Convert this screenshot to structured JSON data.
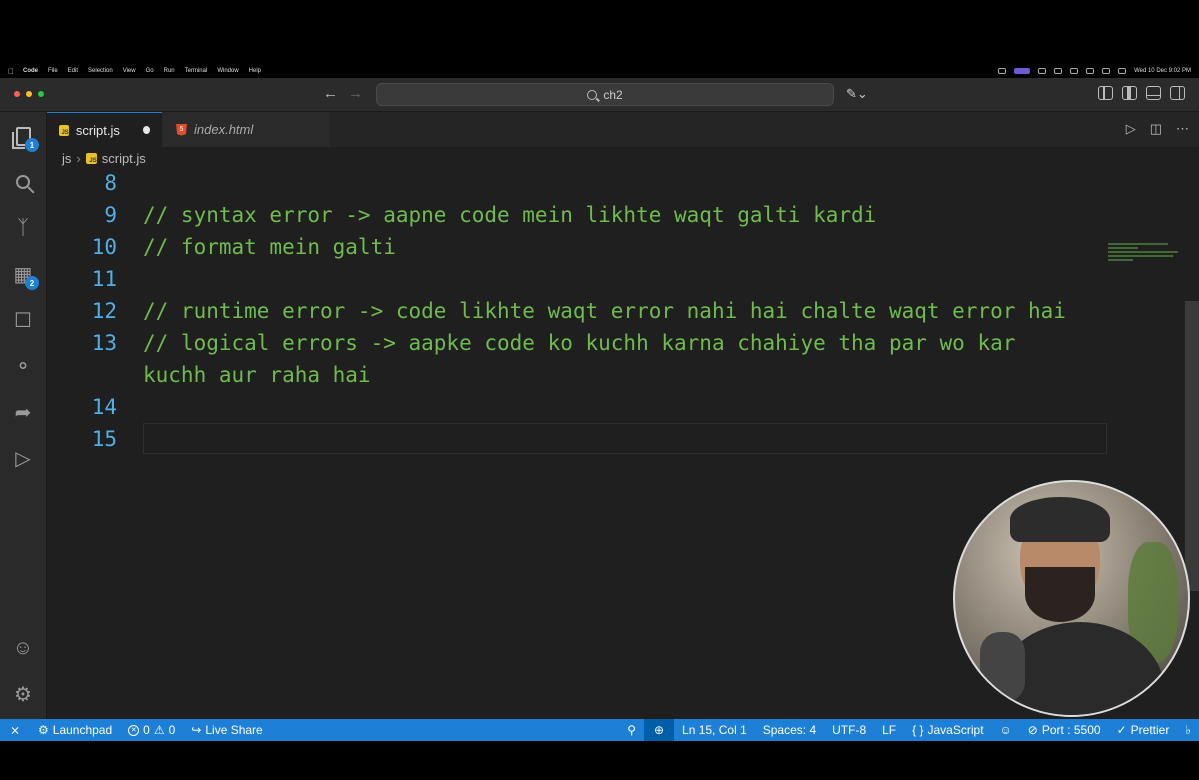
{
  "menubar": {
    "app": "Code",
    "items": [
      "File",
      "Edit",
      "Selection",
      "View",
      "Go",
      "Run",
      "Terminal",
      "Window",
      "Help"
    ],
    "clock": "Wed 10 Dec  9:02 PM"
  },
  "titlebar": {
    "search": "ch2"
  },
  "activity": {
    "explorer_badge": "1",
    "extensions_badge": "2"
  },
  "tabs": [
    {
      "label": "script.js",
      "modified": true
    },
    {
      "label": "index.html"
    }
  ],
  "breadcrumb": {
    "folder": "js",
    "file": "script.js"
  },
  "editor": {
    "lines": [
      {
        "num": "8",
        "text": ""
      },
      {
        "num": "9",
        "text": "// syntax error -> aapne code mein likhte waqt galti kardi"
      },
      {
        "num": "10",
        "text": "// format mein galti"
      },
      {
        "num": "11",
        "text": ""
      },
      {
        "num": "12",
        "text": "// runtime error -> code likhte waqt error nahi hai chalte waqt error hai"
      },
      {
        "num": "13",
        "text": "// logical errors -> aapke code ko kuchh karna chahiye tha par wo kar"
      },
      {
        "num": "",
        "text": "kuchh aur raha hai"
      },
      {
        "num": "14",
        "text": ""
      },
      {
        "num": "15",
        "text": ""
      }
    ]
  },
  "statusbar": {
    "launchpad": "Launchpad",
    "errors": "0",
    "warnings": "0",
    "live_share": "Live Share",
    "position": "Ln 15, Col 1",
    "spaces": "Spaces: 4",
    "encoding": "UTF-8",
    "eol": "LF",
    "language": "JavaScript",
    "port": "Port : 5500",
    "prettier": "Prettier"
  },
  "colors": {
    "accent": "#1e7fd6",
    "comment": "#6a9955",
    "line_number": "#4fb0e8"
  }
}
